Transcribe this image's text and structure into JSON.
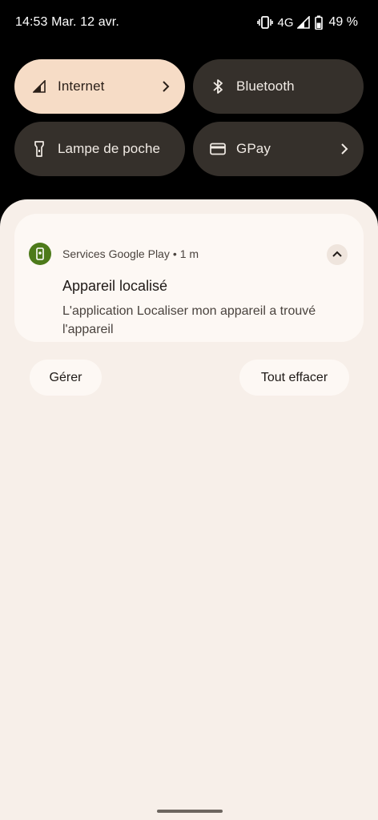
{
  "status_bar": {
    "time_date": "14:53 Mar. 12 avr.",
    "network": "4G",
    "battery": "49 %"
  },
  "quick_settings": {
    "tiles": [
      {
        "label": "Internet",
        "icon": "cell-signal-icon",
        "state": "on",
        "has_chevron": true
      },
      {
        "label": "Bluetooth",
        "icon": "bluetooth-icon",
        "state": "off",
        "has_chevron": false
      },
      {
        "label": "Lampe de poche",
        "icon": "flashlight-icon",
        "state": "off",
        "has_chevron": false
      },
      {
        "label": "GPay",
        "icon": "credit-card-icon",
        "state": "off",
        "has_chevron": true
      }
    ]
  },
  "notification": {
    "app_name": "Services Google Play",
    "separator": "•",
    "time": "1 m",
    "title": "Appareil localisé",
    "text": "L'application Localiser mon appareil a trouvé l'appareil",
    "app_icon": "find-my-device-icon",
    "app_icon_color": "#4d7a1a"
  },
  "actions": {
    "manage": "Gérer",
    "clear_all": "Tout effacer"
  },
  "colors": {
    "active_tile": "#f6dcc6",
    "inactive_tile": "#35302b",
    "shade_background": "#f7efe9",
    "card_background": "#fdf8f4"
  }
}
